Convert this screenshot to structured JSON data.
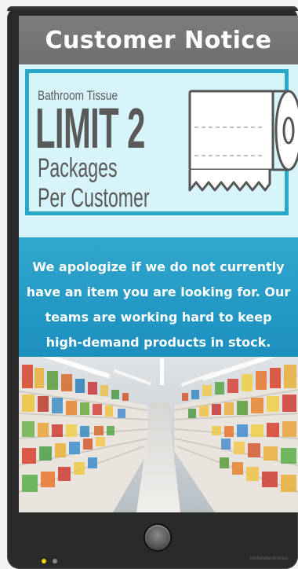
{
  "screen": {
    "header_title": "Customer Notice",
    "limit_sign": {
      "kicker": "Bathroom Tissue",
      "headline": "LIMIT 2",
      "line1": "Packages",
      "line2": "Per Customer",
      "icon": "toilet-paper-roll-icon"
    },
    "message": "We apologize if we do not currently have an item you are looking for. Our teams are working hard to keep high-demand products in stock.",
    "photo": "supermarket-aisle"
  },
  "device": {
    "brand": "clintonelectronics",
    "status_leds": [
      "yellow",
      "gray"
    ]
  },
  "colors": {
    "header_bg": "#777777",
    "accent": "#2aa6c8",
    "limit_bg": "#d7f4fb",
    "message_bg": "#25a0cc",
    "text_dark": "#5a5a5a"
  }
}
